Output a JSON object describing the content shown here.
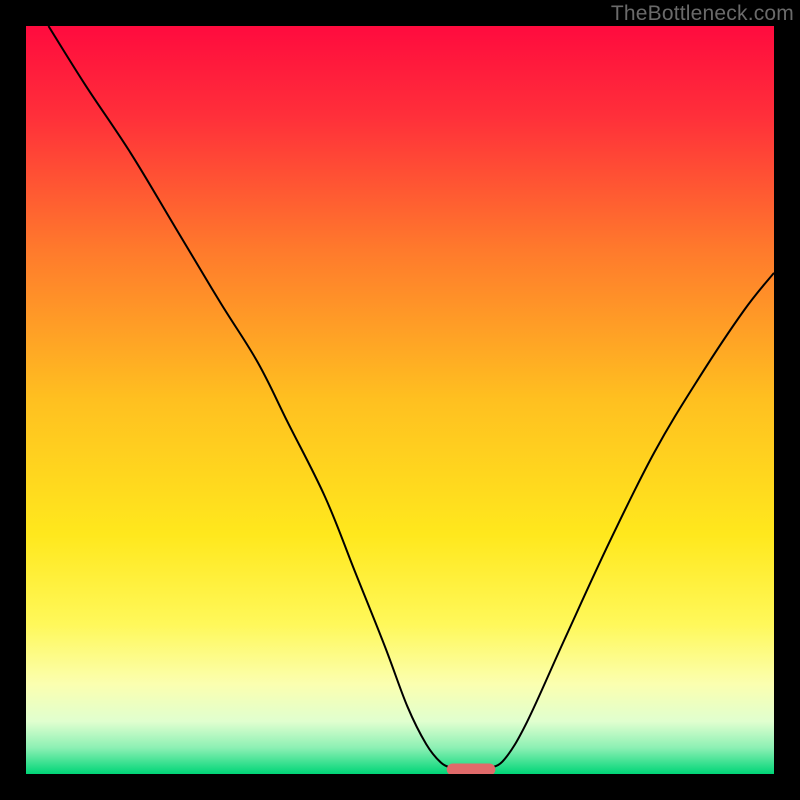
{
  "watermark": "TheBottleneck.com",
  "chart_data": {
    "type": "line",
    "title": "",
    "xlabel": "",
    "ylabel": "",
    "xlim": [
      0,
      100
    ],
    "ylim": [
      0,
      100
    ],
    "grid": false,
    "legend": false,
    "background": {
      "type": "vertical-gradient",
      "stops": [
        {
          "pos": 0.0,
          "color": "#ff0b3e"
        },
        {
          "pos": 0.12,
          "color": "#ff2f3a"
        },
        {
          "pos": 0.3,
          "color": "#ff7a2c"
        },
        {
          "pos": 0.5,
          "color": "#ffc020"
        },
        {
          "pos": 0.68,
          "color": "#ffe81d"
        },
        {
          "pos": 0.8,
          "color": "#fff85a"
        },
        {
          "pos": 0.88,
          "color": "#fbffb0"
        },
        {
          "pos": 0.93,
          "color": "#e0ffcf"
        },
        {
          "pos": 0.965,
          "color": "#8cf0b4"
        },
        {
          "pos": 1.0,
          "color": "#00d577"
        }
      ]
    },
    "series": [
      {
        "name": "bottleneck-curve",
        "color": "#000000",
        "stroke_width": 2,
        "x": [
          3,
          8,
          14,
          20,
          26,
          31,
          35,
          40,
          44,
          48,
          51,
          53.5,
          55.5,
          57,
          58,
          61,
          62,
          64,
          67,
          72,
          78,
          84,
          90,
          96,
          100
        ],
        "y": [
          100,
          92,
          83,
          73,
          63,
          55,
          47,
          37,
          27,
          17,
          9,
          4,
          1.5,
          0.8,
          0.6,
          0.6,
          0.8,
          2,
          7,
          18,
          31,
          43,
          53,
          62,
          67
        ]
      }
    ],
    "marker": {
      "name": "optimal-range",
      "shape": "pill",
      "color": "#e06a6a",
      "cx": 59.5,
      "cy": 0.6,
      "width": 6.5,
      "height": 1.6
    }
  }
}
